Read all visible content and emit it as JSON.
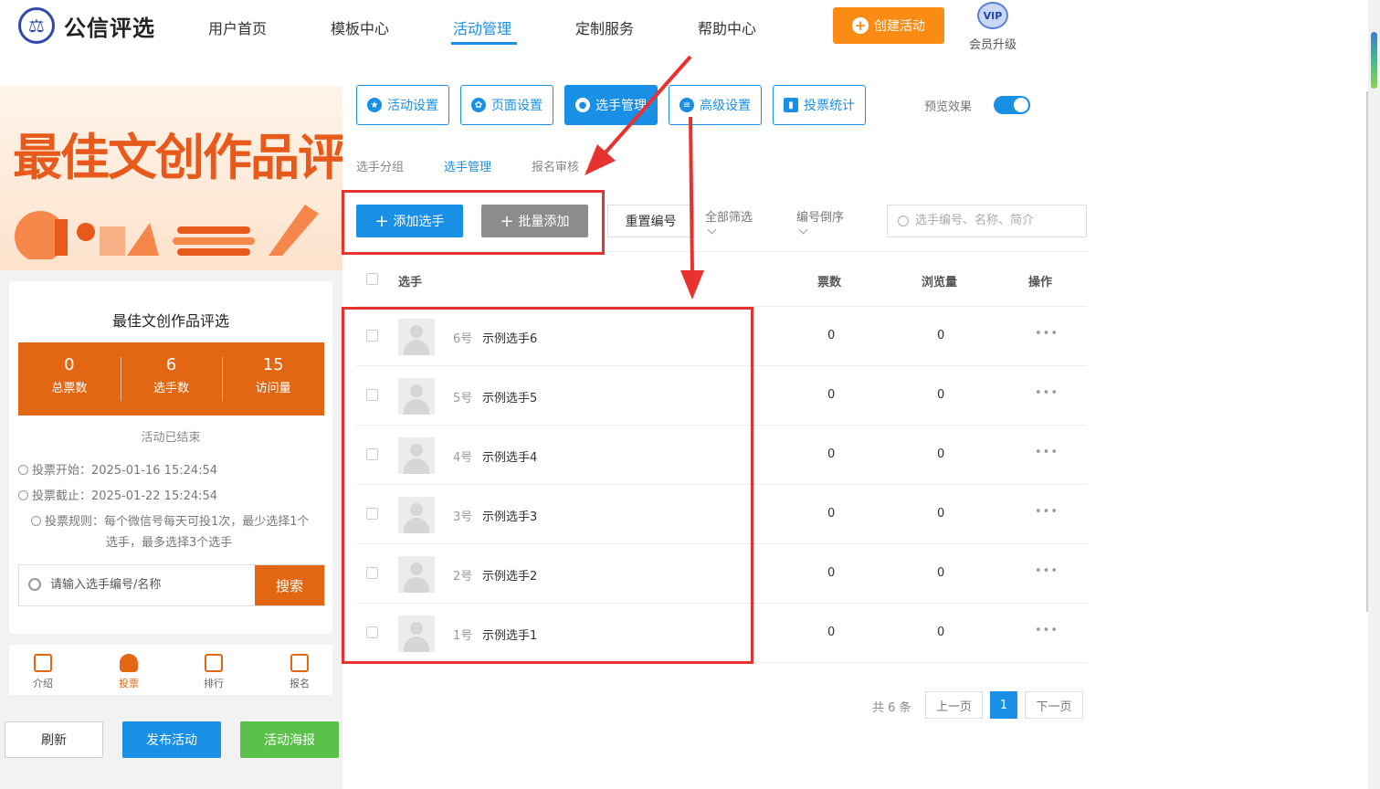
{
  "header": {
    "logo_text": "公信评选",
    "logo_glyph": "⚖",
    "nav": [
      "用户首页",
      "模板中心",
      "活动管理",
      "定制服务",
      "帮助中心"
    ],
    "nav_active": "活动管理",
    "create_button": "创建活动",
    "vip_badge": "VIP",
    "vip_label": "会员升级"
  },
  "preview": {
    "banner_title": "最佳文创作品评选",
    "activity_title": "最佳文创作品评选",
    "stats": [
      {
        "value": "0",
        "label": "总票数"
      },
      {
        "value": "6",
        "label": "选手数"
      },
      {
        "value": "15",
        "label": "访问量"
      }
    ],
    "status": "活动已结束",
    "vote_start": "投票开始：2025-01-16 15:24:54",
    "vote_end": "投票截止：2025-01-22 15:24:54",
    "vote_rule": "投票规则：每个微信号每天可投1次，最少选择1个选手，最多选择3个选手",
    "search_placeholder": "请输入选手编号/名称",
    "search_button": "搜索",
    "tabs": [
      "介绍",
      "投票",
      "排行",
      "报名"
    ],
    "tab_active": "投票",
    "buttons": {
      "refresh": "刷新",
      "publish": "发布活动",
      "poster": "活动海报"
    }
  },
  "toolbar": {
    "tools": [
      "活动设置",
      "页面设置",
      "选手管理",
      "高级设置",
      "投票统计"
    ],
    "tool_active": "选手管理",
    "preview_label": "预览效果",
    "preview_on": true
  },
  "subtabs": [
    "选手分组",
    "选手管理",
    "报名审核"
  ],
  "subtab_active": "选手管理",
  "actions": {
    "add": "添加选手",
    "batch_add": "批量添加",
    "reset_number": "重置编号",
    "filter_all": "全部筛选",
    "sort_desc": "编号倒序",
    "search_placeholder": "选手编号、名称、简介"
  },
  "table": {
    "headers": {
      "player": "选手",
      "votes": "票数",
      "views": "浏览量",
      "ops": "操作"
    },
    "rows": [
      {
        "no": "6号",
        "name": "示例选手6",
        "votes": "0",
        "views": "0"
      },
      {
        "no": "5号",
        "name": "示例选手5",
        "votes": "0",
        "views": "0"
      },
      {
        "no": "4号",
        "name": "示例选手4",
        "votes": "0",
        "views": "0"
      },
      {
        "no": "3号",
        "name": "示例选手3",
        "votes": "0",
        "views": "0"
      },
      {
        "no": "2号",
        "name": "示例选手2",
        "votes": "0",
        "views": "0"
      },
      {
        "no": "1号",
        "name": "示例选手1",
        "votes": "0",
        "views": "0"
      }
    ],
    "more_glyph": "•••"
  },
  "pagination": {
    "total": "共 6 条",
    "prev": "上一页",
    "current": "1",
    "next": "下一页"
  },
  "colors": {
    "primary": "#1a8fe6",
    "orange": "#fa8c16",
    "theme": "#e36712",
    "annotation": "#e8322f",
    "green": "#5bc14b"
  }
}
